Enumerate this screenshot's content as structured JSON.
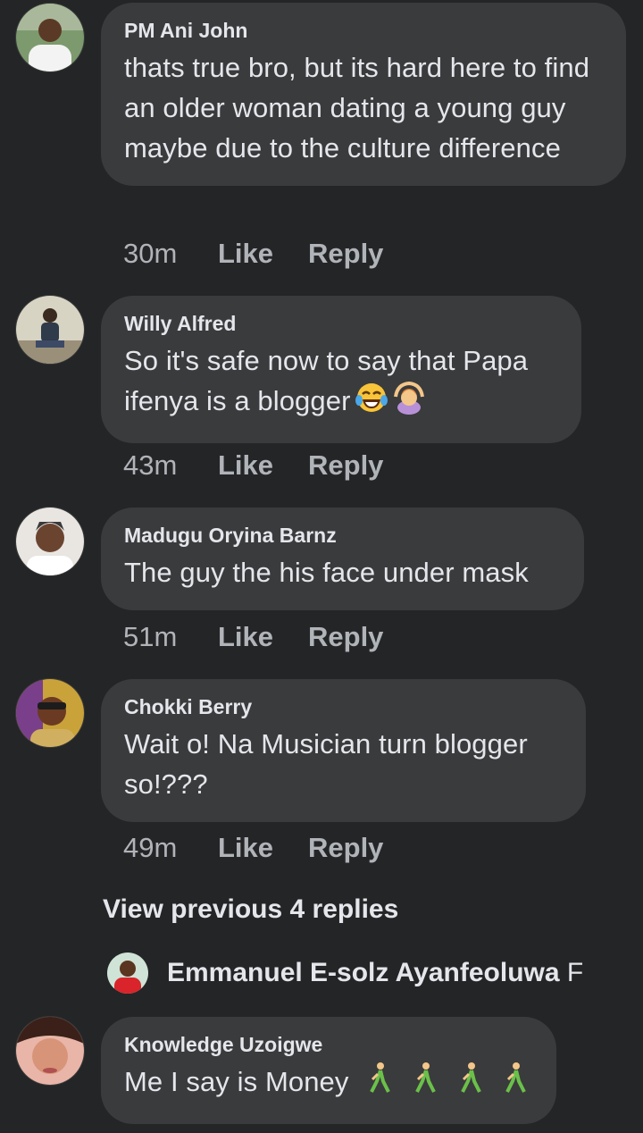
{
  "comments": [
    {
      "author": "PM Ani John",
      "text": "thats true bro, but its hard here to find an older woman dating a young guy maybe due to the culture difference",
      "time": "30m",
      "like": "Like",
      "reply": "Reply",
      "avatar_icon": "user-avatar"
    },
    {
      "author": "Willy Alfred",
      "text": "So it's safe now to say that Papa ifenya is a blogger",
      "time": "43m",
      "like": "Like",
      "reply": "Reply",
      "avatar_icon": "user-avatar",
      "emojis": [
        "tears-of-joy-emoji",
        "person-gesturing-ok-emoji"
      ]
    },
    {
      "author": "Madugu Oryina Barnz",
      "text": "The guy the his face under mask",
      "time": "51m",
      "like": "Like",
      "reply": "Reply",
      "avatar_icon": "user-avatar"
    },
    {
      "author": "Chokki Berry",
      "text": "Wait o! Na Musician turn blogger so!???",
      "time": "49m",
      "like": "Like",
      "reply": "Reply",
      "avatar_icon": "user-avatar"
    },
    {
      "author": "Knowledge Uzoigwe",
      "text": "Me I say is Money",
      "avatar_icon": "user-avatar",
      "emojis": [
        "person-walking-emoji",
        "person-walking-emoji",
        "person-walking-emoji",
        "person-walking-emoji"
      ]
    }
  ],
  "view_previous": "View previous 4 replies",
  "reply_preview": {
    "name": "Emmanuel E-solz Ayanfeoluwa",
    "trailing": "F"
  },
  "colors": {
    "background": "#242526",
    "bubble": "#3a3b3c",
    "text": "#e4e6eb",
    "secondary": "#b0b3b8"
  }
}
